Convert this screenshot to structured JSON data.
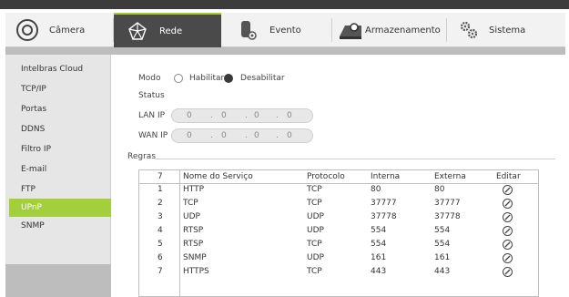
{
  "nav": {
    "tabs": [
      {
        "label": "Câmera",
        "icon": "camera-icon"
      },
      {
        "label": "Rede",
        "icon": "network-icon"
      },
      {
        "label": "Evento",
        "icon": "event-icon"
      },
      {
        "label": "Armazenamento",
        "icon": "storage-icon"
      },
      {
        "label": "Sistema",
        "icon": "gears-icon"
      }
    ],
    "active": "Rede"
  },
  "sidebar": {
    "items": [
      {
        "label": "Intelbras Cloud"
      },
      {
        "label": "TCP/IP"
      },
      {
        "label": "Portas"
      },
      {
        "label": "DDNS"
      },
      {
        "label": "Filtro IP"
      },
      {
        "label": "E-mail"
      },
      {
        "label": "FTP"
      },
      {
        "label": "UPnP"
      },
      {
        "label": "SNMP"
      }
    ],
    "active": "UPnP"
  },
  "upnp": {
    "modo_label": "Modo",
    "habilitar_label": "Habilitar",
    "desabilitar_label": "Desabilitar",
    "selected_mode": "Desabilitar",
    "status_label": "Status",
    "lan_ip_label": "LAN IP",
    "lan_ip": [
      "0",
      "0",
      "0",
      "0"
    ],
    "wan_ip_label": "WAN IP",
    "wan_ip": [
      "0",
      "0",
      "0",
      "0"
    ],
    "regras_label": "Regras",
    "ip_separator": "."
  },
  "rules_table": {
    "headers": [
      "7",
      "Nome do Serviço",
      "Protocolo",
      "Interna",
      "Externa",
      "Editar"
    ],
    "rows": [
      {
        "num": "1",
        "name": "HTTP",
        "protocol": "TCP",
        "internal": "80",
        "external": "80"
      },
      {
        "num": "2",
        "name": "TCP",
        "protocol": "TCP",
        "internal": "37777",
        "external": "37777"
      },
      {
        "num": "3",
        "name": "UDP",
        "protocol": "UDP",
        "internal": "37778",
        "external": "37778"
      },
      {
        "num": "4",
        "name": "RTSP",
        "protocol": "UDP",
        "internal": "554",
        "external": "554"
      },
      {
        "num": "5",
        "name": "RTSP",
        "protocol": "TCP",
        "internal": "554",
        "external": "554"
      },
      {
        "num": "6",
        "name": "SNMP",
        "protocol": "UDP",
        "internal": "161",
        "external": "161"
      },
      {
        "num": "7",
        "name": "HTTPS",
        "protocol": "TCP",
        "internal": "443",
        "external": "443"
      }
    ],
    "edit_icon": "edit-icon"
  },
  "colors": {
    "accent_green": "#a3cf3c",
    "tab_active_bg": "#4a4a4a"
  }
}
